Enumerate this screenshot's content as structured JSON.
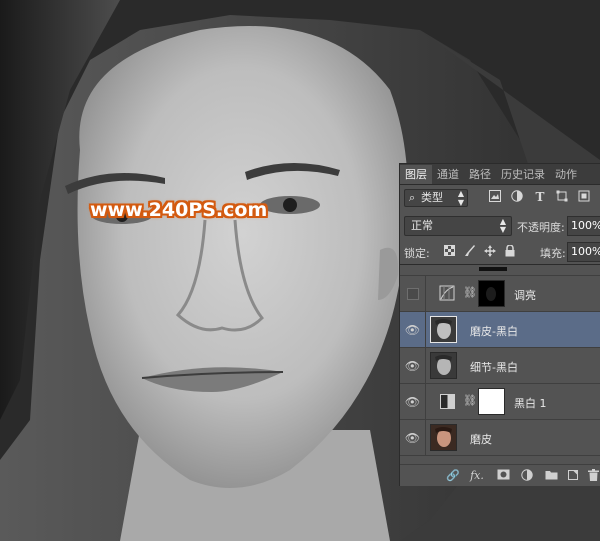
{
  "watermark": "www.240PS.com",
  "panel": {
    "tabs": [
      {
        "label": "图层",
        "active": true
      },
      {
        "label": "通道",
        "active": false
      },
      {
        "label": "路径",
        "active": false
      },
      {
        "label": "历史记录",
        "active": false
      },
      {
        "label": "动作",
        "active": false
      }
    ],
    "filter": {
      "search_glyph": "⌕",
      "kind_label": "类型",
      "icons": [
        "image-filter-icon",
        "adjustment-filter-icon",
        "type-filter-icon",
        "shape-filter-icon",
        "smart-object-filter-icon"
      ]
    },
    "blend_mode": "正常",
    "opacity_label": "不透明度:",
    "opacity_value": "100%",
    "lock_label": "锁定:",
    "lock_icons": [
      "lock-transparent-icon",
      "lock-pixels-icon",
      "lock-position-icon",
      "lock-all-icon"
    ],
    "fill_label": "填充:",
    "fill_value": "100%",
    "layers": [
      {
        "name": "调亮",
        "visible": false,
        "selected": false,
        "type": "curves-adjustment",
        "has_mask": true,
        "mask_color": "#000000"
      },
      {
        "name": "磨皮-黑白",
        "visible": true,
        "selected": true,
        "type": "pixel",
        "has_mask": false
      },
      {
        "name": "细节-黑白",
        "visible": true,
        "selected": false,
        "type": "pixel",
        "has_mask": false
      },
      {
        "name": "黑白 1",
        "visible": true,
        "selected": false,
        "type": "black-white-adjustment",
        "has_mask": true,
        "mask_color": "#ffffff"
      },
      {
        "name": "磨皮",
        "visible": true,
        "selected": false,
        "type": "pixel-color",
        "has_mask": false
      }
    ],
    "bottom_icons": [
      "link-layers-icon",
      "fx-icon",
      "add-mask-icon",
      "new-adjustment-icon",
      "new-group-icon",
      "new-layer-icon",
      "delete-layer-icon"
    ]
  }
}
